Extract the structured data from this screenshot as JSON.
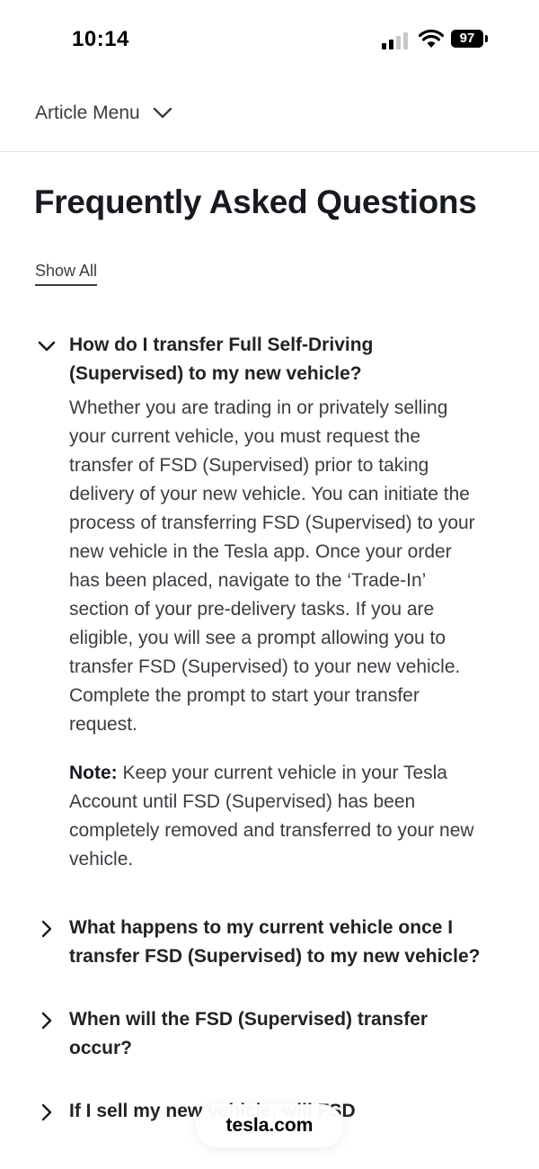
{
  "status_bar": {
    "time": "10:14",
    "battery": "97",
    "icons": [
      "signal-icon",
      "wifi-icon",
      "battery-icon"
    ]
  },
  "article_menu": {
    "label": "Article Menu",
    "icon": "chevron-down-icon"
  },
  "page": {
    "title": "Frequently Asked Questions",
    "show_all": "Show All"
  },
  "faqs": [
    {
      "question": "How do I transfer Full Self-Driving (Supervised) to my new vehicle?",
      "expanded": true,
      "answer": "Whether you are trading in or privately selling your current vehicle, you must request the transfer of FSD (Supervised) prior to taking delivery of your new vehicle. You can initiate the process of transferring FSD (Supervised) to your new vehicle in the Tesla app. Once your order has been placed, navigate to the ‘Trade-In’ section of your pre-delivery tasks. If you are eligible, you will see a prompt allowing you to transfer FSD (Supervised) to your new vehicle. Complete the prompt to start your transfer request.",
      "note_label": "Note:",
      "note_text": " Keep your current vehicle in your Tesla Account until FSD (Supervised) has been completely removed and transferred to your new vehicle."
    },
    {
      "question": "What happens to my current vehicle once I transfer FSD (Supervised) to my new vehicle?",
      "expanded": false
    },
    {
      "question": "When will the FSD (Supervised) transfer occur?",
      "expanded": false
    },
    {
      "question": "If I sell my new vehicle, will FSD",
      "expanded": false
    }
  ],
  "browser": {
    "domain": "tesla.com"
  },
  "colors": {
    "text_primary": "#171a20",
    "text_secondary": "#393c41",
    "divider": "#e2e2e2",
    "background": "#ffffff"
  }
}
